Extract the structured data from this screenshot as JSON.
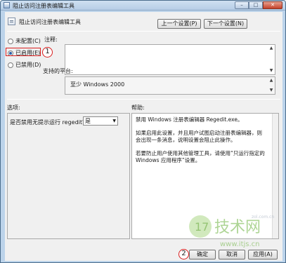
{
  "window": {
    "title": "阻止访问注册表编辑工具",
    "minimize": "–",
    "maximize": "□",
    "close": "✕"
  },
  "header": {
    "policy_title": "阻止访问注册表编辑工具",
    "prev_button": "上一个设置(P)",
    "next_button": "下一个设置(N)"
  },
  "state": {
    "options": [
      {
        "label": "未配置(C)",
        "selected": false
      },
      {
        "label": "已启用(E)",
        "selected": true
      },
      {
        "label": "已禁用(D)",
        "selected": false
      }
    ]
  },
  "comment": {
    "label": "注释:",
    "value": ""
  },
  "platform": {
    "label": "支持的平台:",
    "value": "至少 Windows 2000"
  },
  "sections": {
    "options_label": "选项:",
    "help_label": "帮助:"
  },
  "options": {
    "question": "是否禁用无提示运行 regedit？",
    "select_value": "是"
  },
  "help": {
    "paragraphs": [
      "禁用 Windows 注册表编辑器 Regedit.exe。",
      "如果启用此设置，并且用户试图启动注册表编辑器，则会出现一条消息，说明设置会阻止此操作。",
      "若要防止用户使用其他管理工具，请使用“只运行指定的 Windows 应用程序”设置。"
    ]
  },
  "footer": {
    "ok": "确定",
    "cancel": "取消",
    "apply": "应用(A)"
  },
  "annotations": {
    "step1": "1",
    "step2": "2"
  },
  "watermark": {
    "text": "技术网",
    "domain": "www.itjs.cn",
    "small": "zol.com.cn"
  }
}
